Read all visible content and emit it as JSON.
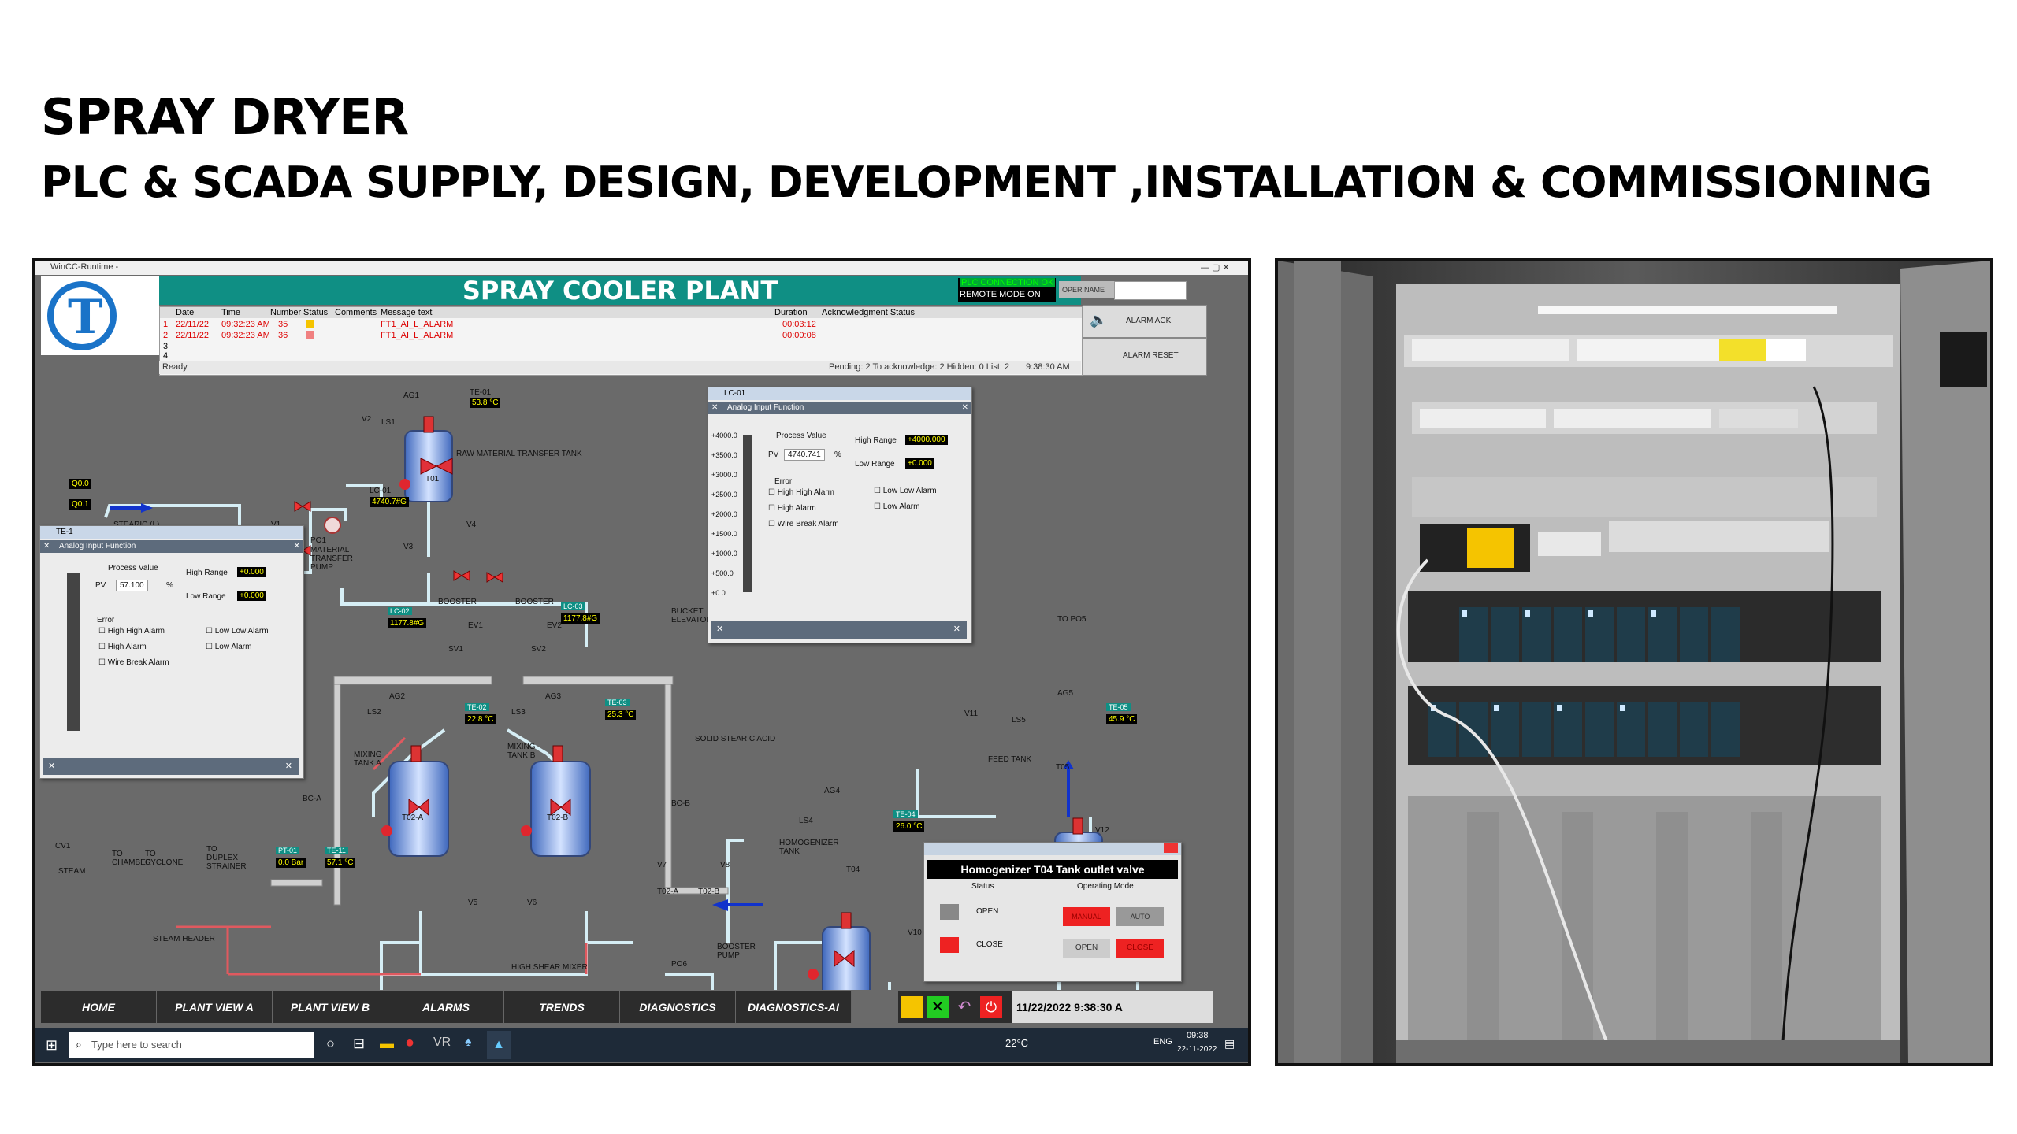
{
  "slide": {
    "title": "SPRAY DRYER",
    "subtitle": "PLC & SCADA SUPPLY, DESIGN, DEVELOPMENT ,INSTALLATION & COMMISSIONING"
  },
  "scada": {
    "window_title": "WinCC-Runtime -",
    "plant_title": "SPRAY COOLER PLANT",
    "plc_connection": "PLC CONNECTION OK",
    "remote_mode": "REMOTE MODE ON",
    "operator_label": "OPER NAME",
    "alarm_ack": "ALARM ACK",
    "alarm_reset": "ALARM RESET",
    "alarm_table": {
      "columns": [
        "Date",
        "Time",
        "Number",
        "Status",
        "Comments",
        "Message text",
        "Duration",
        "Acknowledgment Status"
      ],
      "rows": [
        {
          "idx": "1",
          "date": "22/11/22",
          "time": "09:32:23 AM",
          "number": "35",
          "message": "FT1_AI_L_ALARM",
          "duration": "00:03:12"
        },
        {
          "idx": "2",
          "date": "22/11/22",
          "time": "09:32:23 AM",
          "number": "36",
          "message": "FT1_AI_L_ALARM",
          "duration": "00:00:08"
        },
        {
          "idx": "3"
        },
        {
          "idx": "4"
        }
      ],
      "ready": "Ready",
      "status_line": "Pending: 2   To acknowledge: 2   Hidden: 0   List: 2",
      "clock": "9:38:30 AM"
    },
    "labels": {
      "stearic": "STEARIC (L)",
      "raw_material": "RAW MATERIAL TRANSFER TANK",
      "t01": "T01",
      "lc01": "LC-01",
      "lc01_val": "4740.7#G",
      "po1": "PO1",
      "po1_desc": "MATERIAL TRANSFER PUMP",
      "ls1": "LS1",
      "ag1": "AG1",
      "v1": "V1",
      "v2": "V2",
      "v3": "V3",
      "v4": "V4",
      "te01": "TE-01",
      "te01_val": "53.8 °C",
      "q00": "Q0.0",
      "q01": "Q0.1",
      "lc02": "LC-02",
      "lc02_val": "1177.8#G",
      "lc03": "LC-03",
      "lc03_val": "1177.8#G",
      "booster1": "BOOSTER",
      "booster2": "BOOSTER",
      "ev1": "EV1",
      "ev2": "EV2",
      "sv1": "SV1",
      "sv2": "SV2",
      "bucket": "BUCKET ELEVATOR",
      "ls2": "LS2",
      "ls3": "LS3",
      "ls4": "LS4",
      "ls5": "LS5",
      "ag2": "AG2",
      "ag3": "AG3",
      "ag4": "AG4",
      "ag5": "AG5",
      "t02a": "T02-A",
      "t02b": "T02-B",
      "mix_a": "MIXING TANK A",
      "mix_b": "MIXING TANK B",
      "te02": "TE-02",
      "te02_val": "22.8 °C",
      "te03": "TE-03",
      "te03_val": "25.3 °C",
      "solid": "SOLID STEARIC ACID",
      "bca": "BC-A",
      "bcb": "BC-B",
      "to_po5": "TO PO5",
      "t05": "T05",
      "feed": "FEED TANK",
      "te05": "TE-05",
      "te05_val": "45.9 °C",
      "v11": "V11",
      "v12": "V12",
      "t04": "T04",
      "homog": "HOMOGENIZER TANK",
      "te04": "TE-04",
      "te04_val": "26.0 °C",
      "v5": "V5",
      "v6": "V6",
      "v7": "V7",
      "v8": "V8",
      "v10": "V10",
      "t02a_s": "T02-A",
      "t02b_s": "T02-B",
      "cv1": "CV1",
      "steam": "STEAM",
      "to_chamber": "TO CHAMBER",
      "to_cyclone": "TO CYCLONE",
      "to_duplex": "TO DUPLEX STRAINER",
      "pt01": "PT-01",
      "pt01_val": "0.0 Bar",
      "te11": "TE-11",
      "te11_val": "57.1 °C",
      "steam_header": "STEAM HEADER",
      "hsm": "HIGH SHEAR MIXER",
      "po6": "PO6",
      "booster_pump": "BOOSTER PUMP"
    },
    "dialog_left": {
      "title": "TE-1",
      "sub": "Analog Input Function",
      "process_value": "Process Value",
      "pv": "PV",
      "pv_val": "57.100",
      "unit": "%",
      "high_range": "High Range",
      "high_val": "+0.000",
      "low_range": "Low Range",
      "low_val": "+0.000",
      "error": "Error",
      "checks": [
        "High High Alarm",
        "Low Low Alarm",
        "High Alarm",
        "Low Alarm",
        "Wire Break Alarm"
      ]
    },
    "dialog_right": {
      "title": "LC-01",
      "sub": "Analog Input Function",
      "process_value": "Process Value",
      "pv": "PV",
      "pv_val": "4740.741",
      "unit": "%",
      "high_range": "High Range",
      "high_val": "+4000.000",
      "low_range": "Low Range",
      "low_val": "+0.000",
      "scale": [
        "+4000.0",
        "+3500.0",
        "+3000.0",
        "+2500.0",
        "+2000.0",
        "+1500.0",
        "+1000.0",
        "+500.0",
        "+0.0"
      ],
      "error": "Error",
      "checks": [
        "High High Alarm",
        "Low Low Alarm",
        "High Alarm",
        "Low Alarm",
        "Wire Break Alarm"
      ]
    },
    "valve_dialog": {
      "title": "Homogenizer T04 Tank outlet valve",
      "status": "Status",
      "operating_mode": "Operating Mode",
      "open": "OPEN",
      "close": "CLOSE",
      "manual": "MANUAL",
      "auto": "AUTO",
      "btn_open": "OPEN",
      "btn_close": "CLOSE"
    },
    "nav": [
      "HOME",
      "PLANT VIEW A",
      "PLANT VIEW B",
      "ALARMS",
      "TRENDS",
      "DIAGNOSTICS",
      "DIAGNOSTICS-AI"
    ],
    "datetime": "11/22/2022 9:38:30 A",
    "taskbar": {
      "search": "Type here to search",
      "weather": "22°C",
      "lang": "ENG",
      "time": "09:38",
      "date": "22-11-2022"
    }
  },
  "colors": {
    "header": "#0f8f84",
    "background": "#6a6a6a",
    "pipe": "#cfe8ef",
    "alarm": "#d00000"
  }
}
